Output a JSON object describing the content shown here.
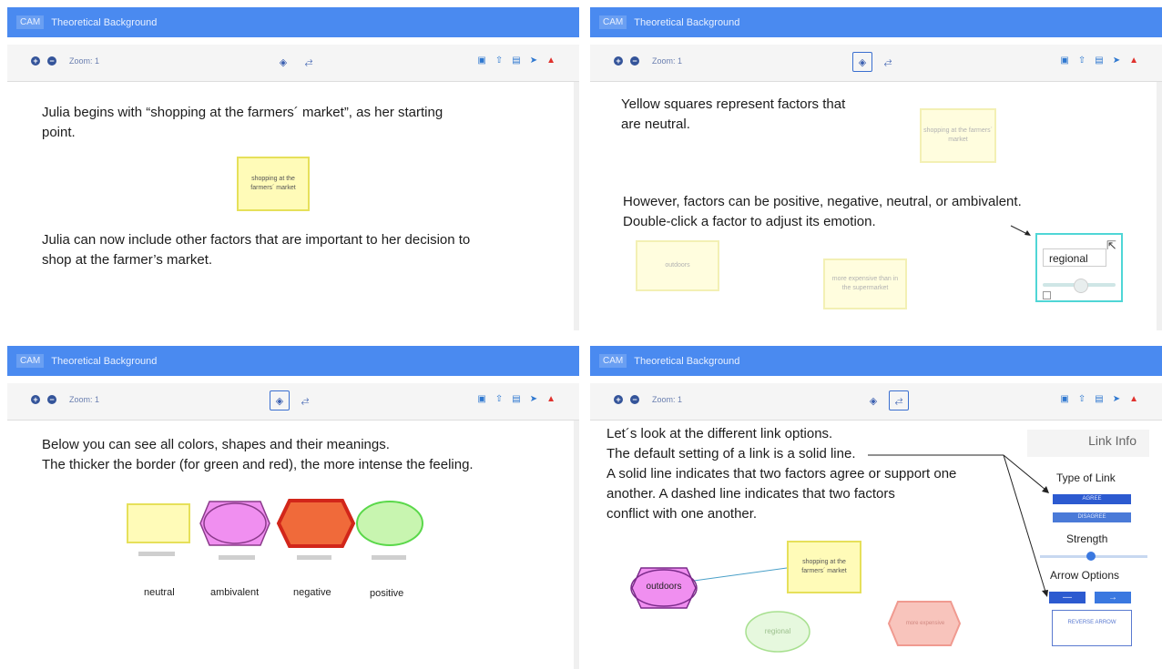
{
  "app": {
    "brand": "CAM",
    "title": "Theoretical Background",
    "zoom_label": "Zoom: 1"
  },
  "panel1": {
    "text1_line1": "Julia begins with “shopping at the farmers´ market”, as her starting",
    "text1_line2": "point.",
    "node_label": "shopping at the farmers´ market",
    "text2_line1": "Julia can now include other factors that are important to her decision to",
    "text2_line2": "shop at the farmer’s market."
  },
  "panel2": {
    "text1_line1": "Yellow squares represent factors that",
    "text1_line2": "are neutral.",
    "node_faded_label": "shopping at the farmers´ market",
    "text2_line1": "However, factors can be positive, negative, neutral, or ambivalent.",
    "text2_line2": "Double-click a factor to adjust its emotion.",
    "node_outdoors": "outdoors",
    "node_expensive": "more expensive than in the supermarket",
    "editor_value": "regional"
  },
  "panel3": {
    "text_line1": "Below you can see all colors, shapes and their meanings.",
    "text_line2": "The thicker the border (for green and red), the more intense the feeling.",
    "legend": [
      "neutral",
      "ambivalent",
      "negative",
      "positive"
    ]
  },
  "panel4": {
    "line1": "Let´s look at the different link options.",
    "line2": "The default setting of a link is a solid line.",
    "line3": "A solid line indicates that two factors agree or support one",
    "line4": "another. A dashed line indicates that two factors",
    "line5": "conflict with one another.",
    "node_outdoors": "outdoors",
    "node_shopping": "shopping at the farmers´ market",
    "node_regional": "regional",
    "node_expensive": "more expensive",
    "link_info": {
      "title": "Link Info",
      "type_label": "Type of Link",
      "agree": "AGREE",
      "disagree": "DISAGREE",
      "strength": "Strength",
      "arrow_options": "Arrow Options",
      "arrow_right": "→",
      "reverse": "REVERSE ARROW"
    }
  },
  "colors": {
    "appbar": "#4a8af0",
    "neutral": "#fffbb8",
    "ambivalent": "#f08ff0",
    "negative": "#f06a3a",
    "positive": "#c8f5b0"
  }
}
